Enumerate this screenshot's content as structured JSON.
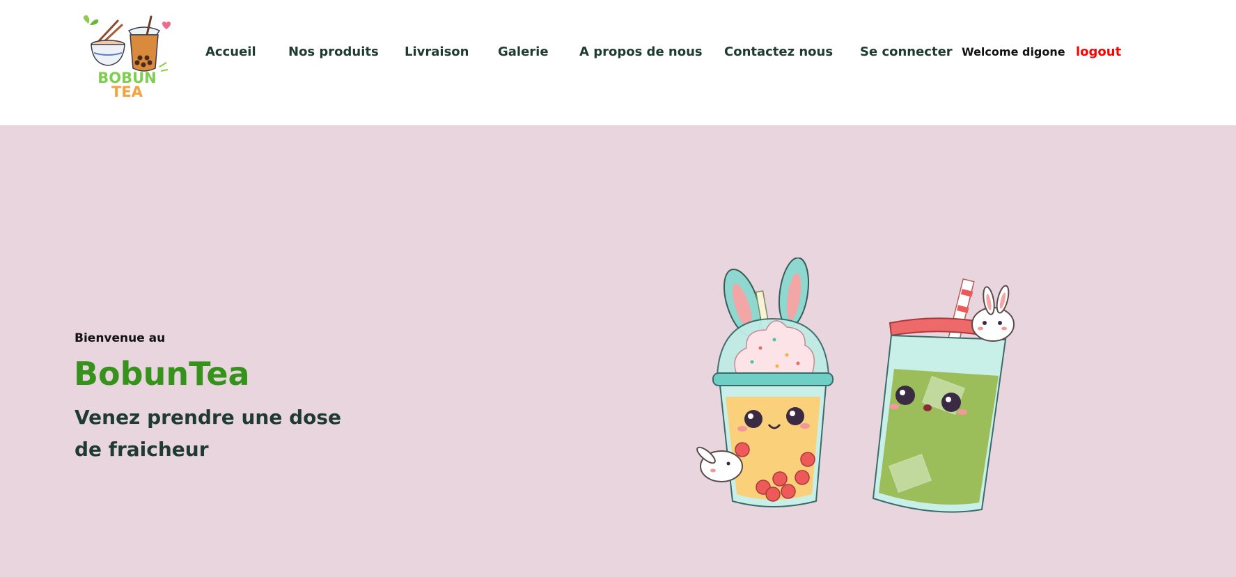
{
  "colors": {
    "hero_bg": "#e8d5dd",
    "nav_text": "#1f3a31",
    "brand_green": "#35921a",
    "logout_red": "#ff0000"
  },
  "logo": {
    "line1": "BOBUN",
    "line2": "TEA"
  },
  "nav": {
    "items": [
      {
        "label": "Accueil"
      },
      {
        "label": "Nos produits"
      },
      {
        "label": "Livraison"
      },
      {
        "label": "Galerie"
      },
      {
        "label": "A propos de nous"
      },
      {
        "label": "Contactez nous"
      },
      {
        "label": "Se connecter"
      }
    ],
    "welcome": "Welcome digone",
    "logout": "logout"
  },
  "hero": {
    "intro": "Bienvenue au",
    "title": "BobunTea",
    "subtitle": "Venez prendre une dose de fraicheur"
  }
}
